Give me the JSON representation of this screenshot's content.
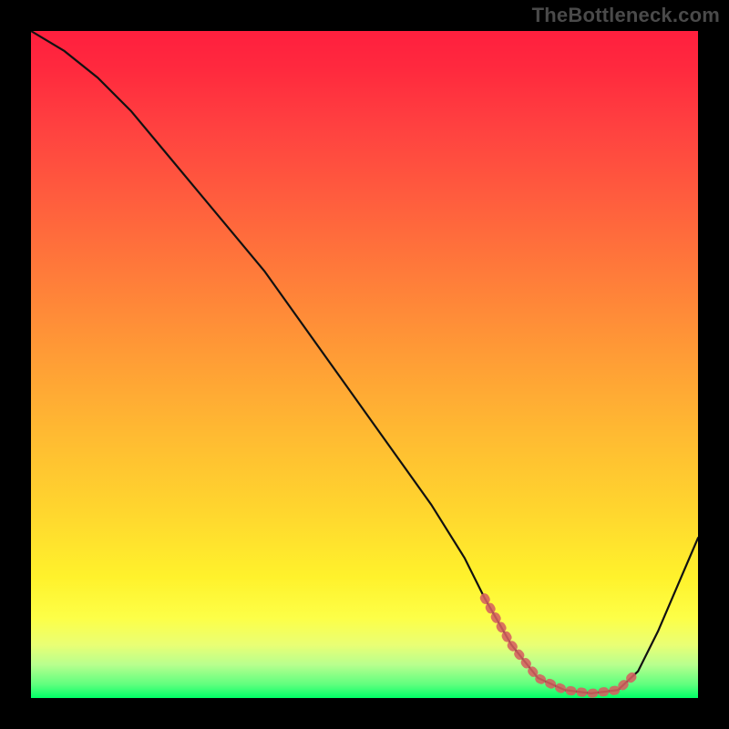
{
  "watermark": "TheBottleneck.com",
  "chart_data": {
    "type": "line",
    "title": "",
    "xlabel": "",
    "ylabel": "",
    "xlim": [
      0,
      100
    ],
    "ylim": [
      0,
      100
    ],
    "grid": false,
    "legend": false,
    "series": [
      {
        "name": "bottleneck-curve",
        "x": [
          0,
          5,
          10,
          15,
          20,
          25,
          30,
          35,
          40,
          45,
          50,
          55,
          60,
          65,
          68,
          72,
          76,
          80,
          84,
          88,
          91,
          94,
          97,
          100
        ],
        "values": [
          100,
          97,
          93,
          88,
          82,
          76,
          70,
          64,
          57,
          50,
          43,
          36,
          29,
          21,
          15,
          8,
          3,
          1.2,
          0.7,
          1.2,
          4,
          10,
          17,
          24
        ]
      }
    ],
    "highlight_range_x": [
      68,
      91
    ],
    "background_gradient": {
      "top": "#ff1f3e",
      "bottom": "#00ff66"
    }
  }
}
